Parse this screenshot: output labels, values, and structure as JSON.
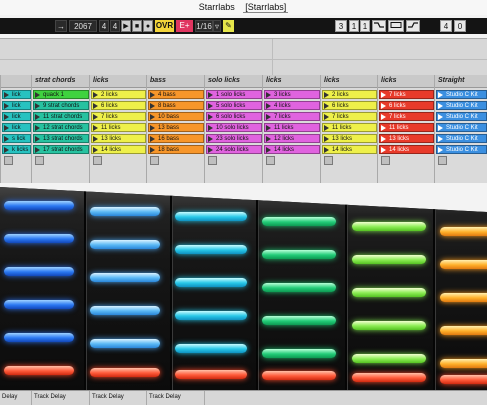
{
  "window": {
    "title": "Starrlabs",
    "set_name": "[Starrlabs]"
  },
  "transport": {
    "follow_icon": "→",
    "position": [
      "2067",
      "4",
      "4"
    ],
    "play_icon": "▶",
    "stop_icon": "■",
    "record_icon": "●",
    "ovr_label": "OVR",
    "rec_mode_label": "E+",
    "quantize": "1/16",
    "quantize_arrow": "▿",
    "pencil_icon": "✎",
    "loop_position": [
      "3",
      "1",
      "1"
    ],
    "end_position": [
      "4",
      "0"
    ]
  },
  "tracks": [
    {
      "name": "",
      "color": "#27c2c0",
      "clips": [
        {
          "label": "lick",
          "color": "#27c2c0"
        },
        {
          "label": "lick",
          "color": "#27c2c0"
        },
        {
          "label": "lick",
          "color": "#27c2c0"
        },
        {
          "label": "lick",
          "color": "#27c2c0"
        },
        {
          "label": "s lick",
          "color": "#27c2c0"
        },
        {
          "label": "k licks",
          "color": "#27c2c0"
        }
      ]
    },
    {
      "name": "strat chords",
      "clips": [
        {
          "label": "quack 1",
          "color": "#3fd23f"
        },
        {
          "label": "9 strat chords",
          "color": "#27c2a0"
        },
        {
          "label": "11 strat chords",
          "color": "#27c2a0"
        },
        {
          "label": "12 strat chords",
          "color": "#27c2a0"
        },
        {
          "label": "13 strat chords",
          "color": "#27c2a0"
        },
        {
          "label": "17 strat chords",
          "color": "#27c2a0"
        }
      ]
    },
    {
      "name": "licks",
      "clips": [
        {
          "label": "2 licks",
          "color": "#eef04a"
        },
        {
          "label": "6 licks",
          "color": "#eef04a"
        },
        {
          "label": "7 licks",
          "color": "#eef04a"
        },
        {
          "label": "11 licks",
          "color": "#eef04a"
        },
        {
          "label": "13 licks",
          "color": "#eef04a"
        },
        {
          "label": "14 licks",
          "color": "#eef04a"
        }
      ]
    },
    {
      "name": "bass",
      "clips": [
        {
          "label": "4 bass",
          "color": "#f7962a"
        },
        {
          "label": "8 bass",
          "color": "#f7962a"
        },
        {
          "label": "10 bass",
          "color": "#f7962a"
        },
        {
          "label": "13 bass",
          "color": "#f7962a"
        },
        {
          "label": "16 bass",
          "color": "#f7962a"
        },
        {
          "label": "18 bass",
          "color": "#f7962a"
        }
      ]
    },
    {
      "name": "solo licks",
      "clips": [
        {
          "label": "1 solo licks",
          "color": "#e063df"
        },
        {
          "label": "5 solo licks",
          "color": "#e063df"
        },
        {
          "label": "6 solo licks",
          "color": "#e063df"
        },
        {
          "label": "10 solo licks",
          "color": "#e063df"
        },
        {
          "label": "23 solo licks",
          "color": "#e063df"
        },
        {
          "label": "24 solo licks",
          "color": "#e063df"
        }
      ]
    },
    {
      "name": "licks",
      "clips": [
        {
          "label": "3 licks",
          "color": "#e063df"
        },
        {
          "label": "4 licks",
          "color": "#e063df"
        },
        {
          "label": "7 licks",
          "color": "#e063df"
        },
        {
          "label": "11 licks",
          "color": "#e063df"
        },
        {
          "label": "12 licks",
          "color": "#e063df"
        },
        {
          "label": "14 licks",
          "color": "#e063df"
        }
      ]
    },
    {
      "name": "licks",
      "clips": [
        {
          "label": "2 licks",
          "color": "#eef04a"
        },
        {
          "label": "6 licks",
          "color": "#eef04a"
        },
        {
          "label": "7 licks",
          "color": "#eef04a"
        },
        {
          "label": "11 licks",
          "color": "#eef04a"
        },
        {
          "label": "13 licks",
          "color": "#eef04a"
        },
        {
          "label": "14 licks",
          "color": "#eef04a"
        }
      ]
    },
    {
      "name": "licks",
      "clips": [
        {
          "label": "7 licks",
          "color": "#e83a2a"
        },
        {
          "label": "6 licks",
          "color": "#e83a2a"
        },
        {
          "label": "7 licks",
          "color": "#e83a2a"
        },
        {
          "label": "11 licks",
          "color": "#e83a2a"
        },
        {
          "label": "13 licks",
          "color": "#e83a2a"
        },
        {
          "label": "14 licks",
          "color": "#e83a2a"
        }
      ]
    },
    {
      "name": "Straight",
      "clips": [
        {
          "label": "Studio C Kit",
          "color": "#3b8fe0"
        },
        {
          "label": "Studio C Kit",
          "color": "#3b8fe0"
        },
        {
          "label": "Studio C Kit",
          "color": "#3b8fe0"
        },
        {
          "label": "Studio C Kit",
          "color": "#3b8fe0"
        },
        {
          "label": "Studio C Kit",
          "color": "#3b8fe0"
        },
        {
          "label": "Studio C Kit",
          "color": "#3b8fe0"
        }
      ]
    }
  ],
  "controller": {
    "pad_colors": [
      "blue",
      "sky",
      "cyan",
      "green",
      "lime",
      "orange"
    ],
    "bottom_row_color": "red"
  },
  "bottom_row": {
    "labels": [
      "Delay",
      "Track Delay",
      "Track Delay",
      "Track Delay"
    ]
  }
}
